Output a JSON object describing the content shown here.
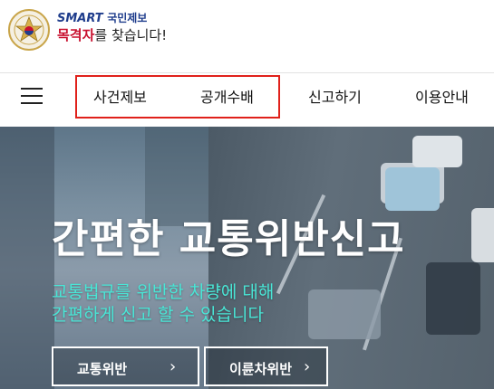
{
  "header": {
    "logo_line1_brand": "SMART",
    "logo_line1_text": "국민제보",
    "logo_line2_red": "목격자",
    "logo_line2_rest": "를 찾습니다!"
  },
  "nav": {
    "items": [
      {
        "label": "사건제보"
      },
      {
        "label": "공개수배"
      },
      {
        "label": "신고하기"
      },
      {
        "label": "이용안내"
      }
    ]
  },
  "hero": {
    "title": "간편한 교통위반신고",
    "subtitle_line1": "교통법규를 위반한 차량에 대해",
    "subtitle_line2": "간편하게 신고 할 수 있습니다",
    "buttons": [
      {
        "label": "교통위반",
        "chevron": "chevron-right-icon"
      },
      {
        "label": "이륜차위반",
        "chevron": "chevron-right-icon"
      }
    ]
  },
  "colors": {
    "brand_blue": "#1f3d8c",
    "brand_red": "#c8102e",
    "highlight_box": "#e0211b",
    "subtitle_teal": "#49e6d6"
  }
}
